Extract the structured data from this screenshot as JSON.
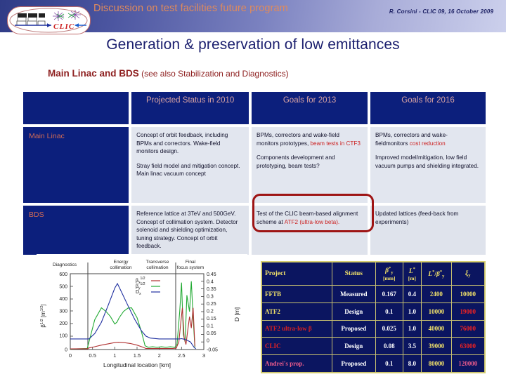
{
  "header": {
    "title": "Discussion on test facilities future program",
    "meta": "R. Corsini - CLIC 09, 16 October 2009",
    "logo_text": "CLIC"
  },
  "slide": {
    "title": "Generation & preservation of low emittances",
    "subtitle_bold": "Main Linac and BDS",
    "subtitle_rest": " (see also Stabilization and Diagnostics)"
  },
  "matrix": {
    "columns": [
      "",
      "Projected Status in 2010",
      "Goals for 2013",
      "Goals for 2016"
    ],
    "rows": [
      {
        "label": "Main Linac",
        "status2010": [
          "Concept of orbit feedback, including BPMs and correctors. Wake-field monitors design.",
          "Stray field model and mitigation concept. Main linac vacuum concept"
        ],
        "goals2013_p1_plain": "BPMs, correctors and wake-field monitors prototypes, ",
        "goals2013_p1_red": "beam tests in CTF3",
        "goals2013_p2": "Components development and prototyping, beam tests?",
        "goals2016_p1_plain": "BPMs, correctors and wake-fieldmonitors ",
        "goals2016_p1_red": "cost reduction",
        "goals2016_p2": "Improved model/mitigation, low field vacuum pumps and shielding integrated."
      },
      {
        "label": "BDS",
        "status2010": [
          "Reference lattice at 3TeV and 500GeV.",
          "Concept of collimation system. Detector solenoid and shielding optimization, tuning strategy. Concept of orbit feedback."
        ],
        "goals2013_p1_plain": "Test of the CLIC beam-based alignment scheme at ",
        "goals2013_p1_red": "ATF2 (ultra-low beta).",
        "goals2016_p1_plain": "Updated lattices (feed-back from experiments)"
      }
    ]
  },
  "chart_data": {
    "type": "line",
    "title": "",
    "xlabel": "Longitudinal location [km]",
    "ylabel": "β^1/2 [m^1/2]",
    "y2label": "D [m]",
    "xlim": [
      0,
      3
    ],
    "ylim": [
      0,
      600
    ],
    "y2lim": [
      -0.05,
      0.45
    ],
    "xticks": [
      0,
      0.5,
      1,
      1.5,
      2,
      2.5,
      3
    ],
    "yticks": [
      0,
      100,
      200,
      300,
      400,
      500,
      600
    ],
    "y2ticks": [
      -0.05,
      0,
      0.05,
      0.1,
      0.15,
      0.2,
      0.25,
      0.3,
      0.35,
      0.4,
      0.45
    ],
    "grid": false,
    "legend_position": "upper-center",
    "section_labels": [
      "Diagnostics",
      "Energy collimation",
      "Transverse collimation",
      "Final focus system"
    ],
    "section_boundaries": [
      0.4,
      2.36,
      2.52
    ],
    "series": [
      {
        "name": "βx^1/2",
        "color": "#b03030",
        "axis": "left",
        "x": [
          0,
          0.2,
          0.38,
          0.42,
          0.55,
          0.7,
          0.85,
          1.0,
          1.08,
          1.2,
          1.35,
          1.5,
          1.62,
          1.7,
          1.85,
          2.0,
          2.15,
          2.3,
          2.38,
          2.44,
          2.48,
          2.52,
          2.56,
          2.6,
          2.64,
          2.68,
          2.72,
          2.76,
          2.8
        ],
        "y": [
          5,
          6,
          6,
          12,
          22,
          35,
          45,
          55,
          58,
          55,
          48,
          35,
          20,
          8,
          8,
          8,
          8,
          8,
          10,
          60,
          200,
          330,
          90,
          40,
          150,
          260,
          170,
          330,
          25
        ]
      },
      {
        "name": "βy^1/2",
        "color": "#22aa33",
        "axis": "left",
        "x": [
          0,
          0.2,
          0.38,
          0.42,
          0.55,
          0.7,
          0.8,
          0.9,
          1.0,
          1.05,
          1.1,
          1.2,
          1.3,
          1.38,
          1.5,
          1.6,
          1.68,
          1.75,
          1.85,
          1.95,
          2.05,
          2.15,
          2.25,
          2.35,
          2.4,
          2.46,
          2.5,
          2.54,
          2.58,
          2.62,
          2.68,
          2.72,
          2.76,
          2.8
        ],
        "y": [
          4,
          6,
          8,
          60,
          230,
          330,
          300,
          260,
          200,
          215,
          250,
          300,
          328,
          330,
          250,
          140,
          30,
          18,
          22,
          18,
          22,
          18,
          22,
          18,
          40,
          300,
          530,
          120,
          60,
          430,
          300,
          540,
          260,
          20
        ]
      },
      {
        "name": "Dx",
        "color": "#2030a0",
        "axis": "right",
        "x": [
          0,
          0.2,
          0.38,
          0.42,
          0.55,
          0.7,
          0.85,
          1.0,
          1.06,
          1.15,
          1.3,
          1.45,
          1.6,
          1.7,
          1.8,
          2.0,
          2.2,
          2.36,
          2.45,
          2.5,
          2.56,
          2.62,
          2.7,
          2.78,
          2.82
        ],
        "y": [
          0.02,
          0.02,
          0.02,
          0.02,
          0.055,
          0.13,
          0.24,
          0.355,
          0.385,
          0.33,
          0.235,
          0.145,
          0.07,
          0.035,
          0.022,
          0.02,
          0.02,
          0.02,
          0.02,
          0.022,
          0.018,
          0.012,
          0.0,
          -0.035,
          -0.045
        ]
      }
    ]
  },
  "params_table": {
    "headers": [
      "Project",
      "Status",
      "β*y",
      "L*",
      "L*/β*y",
      "ξy"
    ],
    "units": [
      "",
      "",
      "[mm]",
      "[m]",
      "",
      ""
    ],
    "rows": [
      {
        "project": "FFTB",
        "project_color": "yellow",
        "status": "Measured",
        "beta": "0.167",
        "lstar": "0.4",
        "ratio": "2400",
        "xi": "10000",
        "xi_color": "yellow"
      },
      {
        "project": "ATF2",
        "project_color": "yellow",
        "status": "Design",
        "beta": "0.1",
        "lstar": "1.0",
        "ratio": "10000",
        "xi": "19000",
        "xi_color": "red"
      },
      {
        "project": "ATF2 ultra-low β",
        "project_color": "red",
        "status": "Proposed",
        "beta": "0.025",
        "lstar": "1.0",
        "ratio": "40000",
        "xi": "76000",
        "xi_color": "red"
      },
      {
        "project": "CLIC",
        "project_color": "red",
        "status": "Design",
        "beta": "0.08",
        "lstar": "3.5",
        "ratio": "39000",
        "xi": "63000",
        "xi_color": "red"
      },
      {
        "project": "Andrei's prop.",
        "project_color": "pink",
        "status": "Proposed",
        "beta": "0.1",
        "lstar": "8.0",
        "ratio": "80000",
        "xi": "120000",
        "xi_color": "pink"
      }
    ]
  },
  "colors": {
    "header_gradient_start": "#2f3b86",
    "header_gradient_end": "#ccd0ec",
    "header_title": "#e08a5c",
    "slide_title": "#1b1f6e",
    "subtitle": "#8e2020",
    "table_header_bg": "#0c1f7c",
    "table_header_text": "#d9a3a3",
    "row_label_text": "#d06a55",
    "body_bg": "#e2e6ef",
    "accent_red": "#cc2222",
    "highlight_border": "#9e1414",
    "param_table_bg": "#0b1560",
    "param_table_text": "#f2e26a"
  }
}
